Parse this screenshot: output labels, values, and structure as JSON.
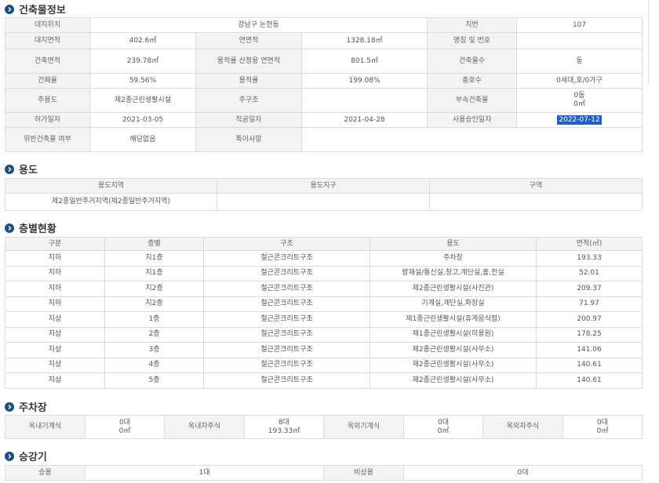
{
  "building": {
    "title": "건축물정보",
    "rows": [
      [
        "대지위치",
        "강남구 논현동",
        "지번",
        "107"
      ],
      [
        "대지면적",
        "402.6㎡",
        "연면적",
        "1328.18㎡",
        "명칭 및 번호",
        ""
      ],
      [
        "건축면적",
        "239.78㎡",
        "용적률 산정용 연면적",
        "801.5㎡",
        "건축물수",
        "동"
      ],
      [
        "건폐율",
        "59.56%",
        "용적률",
        "199.08%",
        "총호수",
        "0세대,호/0가구"
      ],
      [
        "주용도",
        "제2종근린생활시설",
        "주구조",
        "",
        "부속건축물",
        "0동",
        "0㎡"
      ],
      [
        "허가일자",
        "2021-03-05",
        "착공일자",
        "2021-04-28",
        "사용승인일자",
        "2022-07-12"
      ],
      [
        "위반건축물 여부",
        "해당없음",
        "특이사항",
        ""
      ]
    ]
  },
  "usage": {
    "title": "용도",
    "headers": [
      "용도지역",
      "용도지구",
      "구역"
    ],
    "row": [
      "제2종일반주거지역(제2종일반주거지역)",
      "",
      ""
    ]
  },
  "floors": {
    "title": "층별현황",
    "headers": [
      "구분",
      "층별",
      "구조",
      "용도",
      "면적(㎡)"
    ],
    "rows": [
      [
        "지하",
        "지1층",
        "철근콘크리트구조",
        "주차장",
        "193.33"
      ],
      [
        "지하",
        "지1층",
        "철근콘크리트구조",
        "방재실/통신실,창고,계단실,홀,전실",
        "52.01"
      ],
      [
        "지하",
        "지2층",
        "철근콘크리트구조",
        "제2종근린생활시설(사진관)",
        "209.37"
      ],
      [
        "지하",
        "지2층",
        "철근콘크리트구조",
        "기계실,계단실,화장실",
        "71.97"
      ],
      [
        "지상",
        "1층",
        "철근콘크리트구조",
        "제1종근린생활시설(휴게음식점)",
        "200.97"
      ],
      [
        "지상",
        "2층",
        "철근콘크리트구조",
        "제1종근린생활시설(미용원)",
        "178.25"
      ],
      [
        "지상",
        "3층",
        "철근콘크리트구조",
        "제2종근린생활시설(사무소)",
        "141.06"
      ],
      [
        "지상",
        "4층",
        "철근콘크리트구조",
        "제2종근린생활시설(사무소)",
        "140.61"
      ],
      [
        "지상",
        "5층",
        "철근콘크리트구조",
        "제2종근린생활시설(사무소)",
        "140.61"
      ]
    ]
  },
  "parking": {
    "title": "주차장",
    "cells": [
      {
        "label": "옥내기계식",
        "count": "0대",
        "area": "0㎡"
      },
      {
        "label": "옥내자주식",
        "count": "8대",
        "area": "193.33㎡"
      },
      {
        "label": "옥외기계식",
        "count": "0대",
        "area": "0㎡"
      },
      {
        "label": "옥외자주식",
        "count": "0대",
        "area": "0㎡"
      }
    ]
  },
  "elevator": {
    "title": "승강기",
    "row": [
      "승용",
      "1대",
      "비상용",
      "0대"
    ]
  },
  "colors": {
    "accent": "#1a4f86",
    "header_bg": "#f3f3f3",
    "border": "#dcdcdc",
    "highlight": "#1d60c9"
  }
}
